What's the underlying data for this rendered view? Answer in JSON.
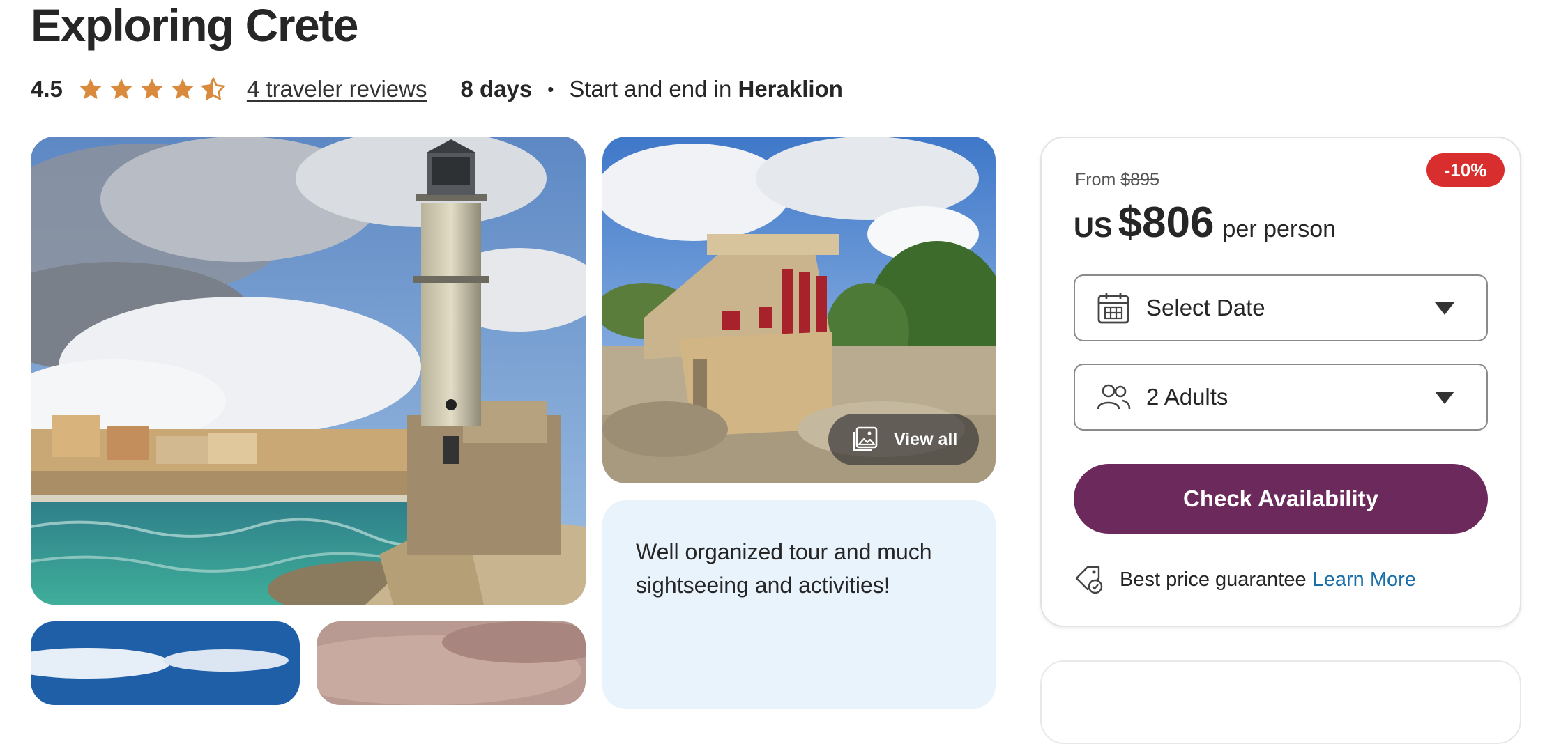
{
  "tour": {
    "title": "Exploring Crete",
    "rating": "4.5",
    "rating_value": 4.5,
    "rating_max": 5,
    "reviews_link": "4 traveler reviews",
    "duration": "8 days",
    "separator": "•",
    "start_end_prefix": "Start and end in",
    "start_end_city": "Heraklion"
  },
  "gallery": {
    "main_photo": "Chania lighthouse and harbour",
    "second_photo": "Knossos palace ruins",
    "view_all_label": "View all",
    "view_all_icon": "image-gallery-icon"
  },
  "review_snippet": {
    "text": "Well organized tour and much sightseeing and activities!"
  },
  "booking": {
    "from_label": "From",
    "original_price": "$895",
    "discount_badge": "-10%",
    "currency": "US",
    "price": "$806",
    "per_label": "per person",
    "date_select": {
      "label": "Select Date",
      "icon": "calendar-icon"
    },
    "travelers_select": {
      "label": "2 Adults",
      "icon": "people-icon"
    },
    "cta_label": "Check Availability",
    "guarantee_text": "Best price guarantee",
    "learn_more": "Learn More",
    "guarantee_icon": "price-tag-check-icon"
  },
  "colors": {
    "star": "#d98a3c",
    "cta": "#6b2a5b",
    "discount": "#d92e2e",
    "link": "#1a6fa8",
    "review_bg": "#e9f3fc"
  }
}
